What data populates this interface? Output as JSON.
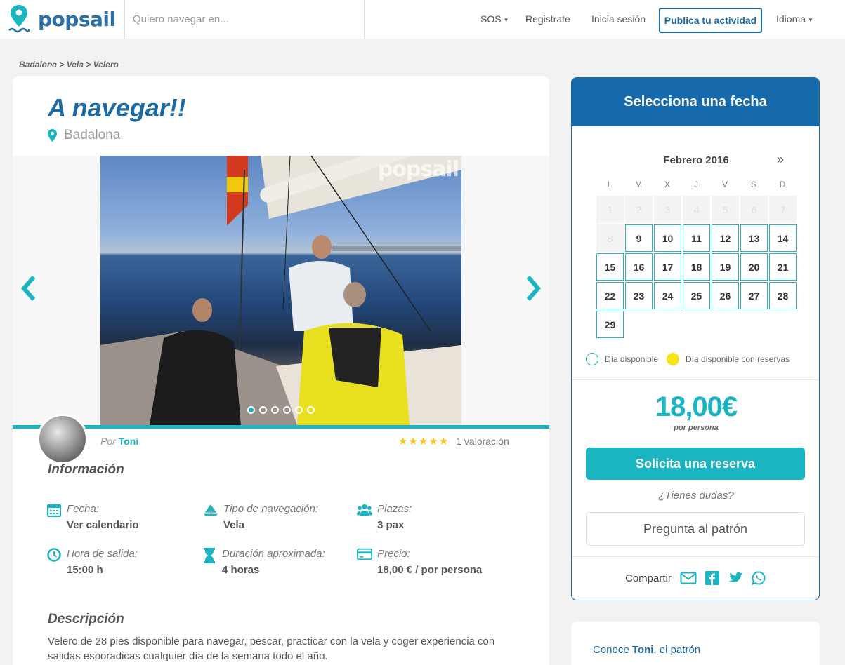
{
  "brand": {
    "name": "popsail"
  },
  "header": {
    "search_placeholder": "Quiero navegar en...",
    "nav": {
      "sos": "SOS",
      "register": "Registrate",
      "login": "Inicia sesión",
      "publish": "Publica tu actividad",
      "language": "Idioma"
    }
  },
  "breadcrumb": "Badalona > Vela > Velero",
  "activity": {
    "title": "A navegar!!",
    "location": "Badalona",
    "gallery": {
      "watermark": "popsail",
      "slide_count": 6,
      "active_slide": 1
    },
    "owner_prefix": "Por",
    "owner_name": "Toni",
    "stars": "★★★★★",
    "rating_text": "1 valoración"
  },
  "info": {
    "heading": "Información",
    "items": [
      {
        "icon": "calendar-icon",
        "label": "Fecha:",
        "value": "Ver calendario"
      },
      {
        "icon": "sailboat-icon",
        "label": "Tipo de navegación:",
        "value": "Vela"
      },
      {
        "icon": "people-icon",
        "label": "Plazas:",
        "value": "3 pax"
      },
      {
        "icon": "clock-icon",
        "label": "Hora de salida:",
        "value": "15:00 h"
      },
      {
        "icon": "hourglass-icon",
        "label": "Duración aproximada:",
        "value": "4 horas"
      },
      {
        "icon": "credit-card-icon",
        "label": "Precio:",
        "value": "18,00 € / por persona"
      }
    ]
  },
  "description": {
    "heading": "Descripción",
    "text": "Velero de 28 pies disponible para navegar, pescar, practicar con la vela y coger experiencia con salidas esporadicas cualquier día de la semana todo el año."
  },
  "booking": {
    "heading": "Selecciona una fecha",
    "month": "Febrero 2016",
    "next_icon": "»",
    "weekdays": [
      "L",
      "M",
      "X",
      "J",
      "V",
      "S",
      "D"
    ],
    "days_unavailable": [
      "1",
      "2",
      "3",
      "4",
      "5",
      "6",
      "7",
      "8"
    ],
    "days_available": [
      "9",
      "10",
      "11",
      "12",
      "13",
      "14",
      "15",
      "16",
      "17",
      "18",
      "19",
      "20",
      "21",
      "22",
      "23",
      "24",
      "25",
      "26",
      "27",
      "28",
      "29"
    ],
    "legend_available": "Día disponible",
    "legend_booked": "Día disponible con reservas",
    "price": "18,00€",
    "price_unit": "por persona",
    "reserve_button": "Solicita una reserva",
    "doubts": "¿Tienes dudas?",
    "ask_button": "Pregunta al patrón",
    "share_label": "Compartir",
    "share_icons": [
      "email-icon",
      "facebook-icon",
      "twitter-icon",
      "whatsapp-icon"
    ]
  },
  "owner_card": {
    "prefix": "Conoce",
    "name": "Toni",
    "suffix": ", el patrón"
  },
  "colors": {
    "brand_blue": "#1c6aa4",
    "teal": "#1ab5c1",
    "booked_yellow": "#f5e31c",
    "star": "#f4c21b"
  }
}
